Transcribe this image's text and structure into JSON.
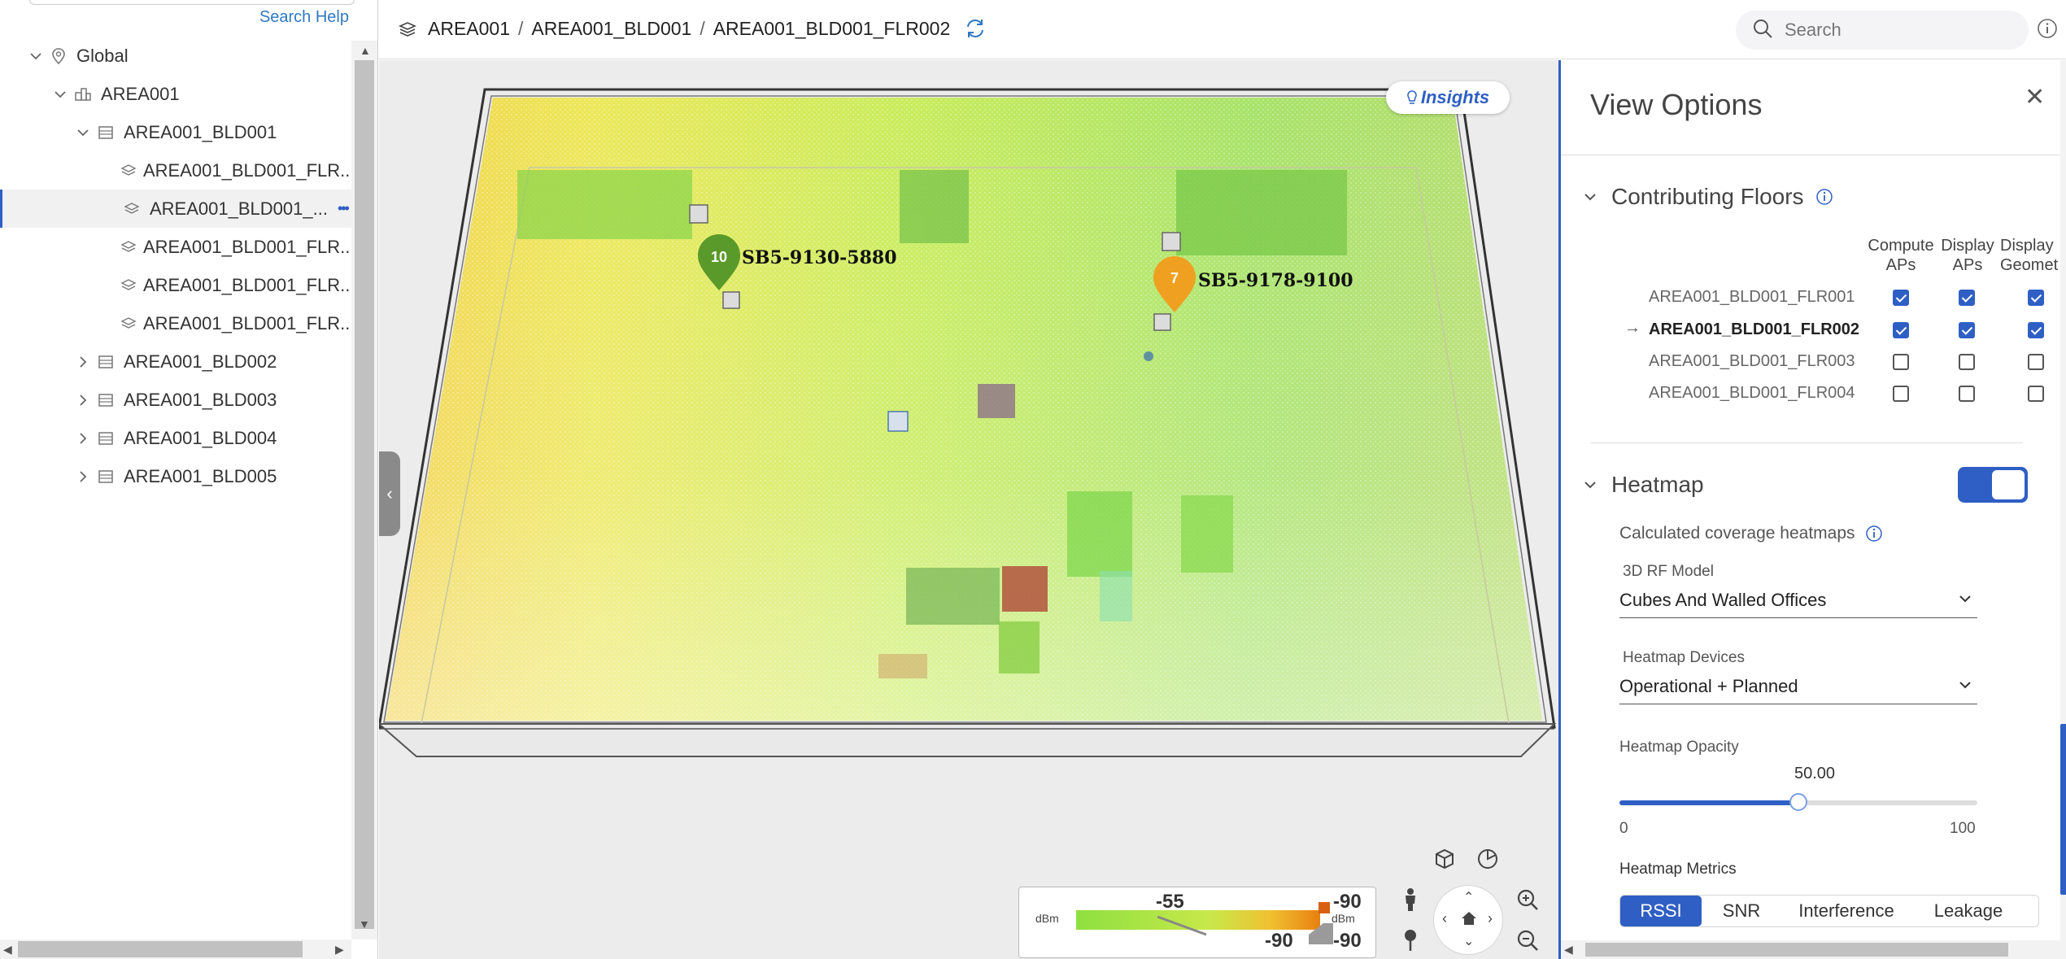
{
  "tree": {
    "search_help": "Search Help",
    "items": [
      {
        "label": "Global",
        "level": 0,
        "expanded": true,
        "icon": "location-pin-icon"
      },
      {
        "label": "AREA001",
        "level": 1,
        "expanded": true,
        "icon": "area-icon"
      },
      {
        "label": "AREA001_BLD001",
        "level": 2,
        "expanded": true,
        "icon": "building-icon"
      },
      {
        "label": "AREA001_BLD001_FLR...",
        "level": 3,
        "icon": "floor-icon"
      },
      {
        "label": "AREA001_BLD001_...",
        "level": 3,
        "icon": "floor-icon",
        "selected": true
      },
      {
        "label": "AREA001_BLD001_FLR...",
        "level": 3,
        "icon": "floor-icon"
      },
      {
        "label": "AREA001_BLD001_FLR...",
        "level": 3,
        "icon": "floor-icon"
      },
      {
        "label": "AREA001_BLD001_FLR...",
        "level": 3,
        "icon": "floor-icon"
      },
      {
        "label": "AREA001_BLD002",
        "level": 2,
        "expanded": false,
        "icon": "building-icon"
      },
      {
        "label": "AREA001_BLD003",
        "level": 2,
        "expanded": false,
        "icon": "building-icon"
      },
      {
        "label": "AREA001_BLD004",
        "level": 2,
        "expanded": false,
        "icon": "building-icon"
      },
      {
        "label": "AREA001_BLD005",
        "level": 2,
        "expanded": false,
        "icon": "building-icon"
      }
    ]
  },
  "header": {
    "breadcrumb": [
      "AREA001",
      "AREA001_BLD001",
      "AREA001_BLD001_FLR002"
    ],
    "breadcrumb_sep": "/",
    "search_placeholder": "Search"
  },
  "map": {
    "insights_label": "Insights",
    "aps": [
      {
        "count": "10",
        "name": "SB5-9130-5880",
        "color": "#5a9a2a"
      },
      {
        "count": "7",
        "name": "SB5-9178-9100",
        "color": "#f0a020"
      }
    ],
    "legend": {
      "unit_left": "dBm",
      "unit_right": "dBm",
      "marker_value": "-55",
      "top_right_value": "-90",
      "bottom_mid_value": "-90",
      "bottom_right_value": "-90"
    }
  },
  "view_options": {
    "title": "View Options",
    "contributing_floors": {
      "title": "Contributing Floors",
      "columns": [
        {
          "line1": "Compute",
          "line2": "APs"
        },
        {
          "line1": "Display",
          "line2": "APs"
        },
        {
          "line1": "Display",
          "line2": "Geomet"
        }
      ],
      "current_marker": "→",
      "rows": [
        {
          "floor": "AREA001_BLD001_FLR001",
          "compute": true,
          "display_aps": true,
          "display_geom": true,
          "current": false
        },
        {
          "floor": "AREA001_BLD001_FLR002",
          "compute": true,
          "display_aps": true,
          "display_geom": true,
          "current": true
        },
        {
          "floor": "AREA001_BLD001_FLR003",
          "compute": false,
          "display_aps": false,
          "display_geom": false,
          "current": false
        },
        {
          "floor": "AREA001_BLD001_FLR004",
          "compute": false,
          "display_aps": false,
          "display_geom": false,
          "current": false
        }
      ]
    },
    "heatmap": {
      "title": "Heatmap",
      "enabled": true,
      "calculated_label": "Calculated coverage heatmaps",
      "rf_model_label": "3D RF Model",
      "rf_model_value": "Cubes And Walled Offices",
      "devices_label": "Heatmap Devices",
      "devices_value": "Operational + Planned",
      "opacity_label": "Heatmap Opacity",
      "opacity_value": "50.00",
      "opacity_fraction": 0.5,
      "opacity_min": "0",
      "opacity_max": "100",
      "metrics_label": "Heatmap Metrics",
      "metrics": [
        "RSSI",
        "SNR",
        "Interference",
        "Leakage"
      ],
      "active_metric": "RSSI"
    }
  },
  "colors": {
    "accent": "#2f5fc4",
    "link": "#2f78c4"
  }
}
